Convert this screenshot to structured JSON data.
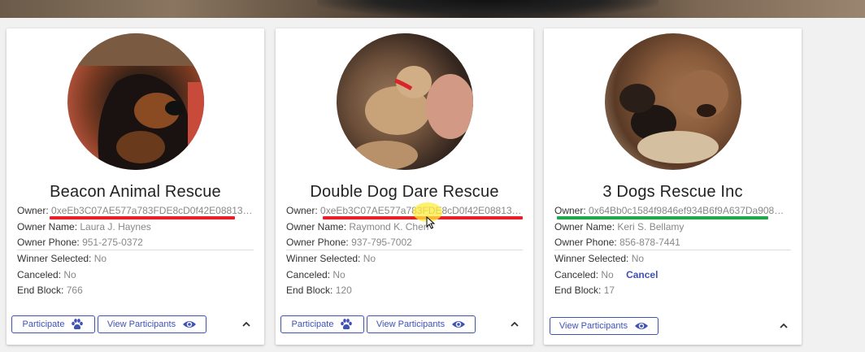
{
  "labels": {
    "owner": "Owner:",
    "owner_name": "Owner Name:",
    "owner_phone": "Owner Phone:",
    "winner_selected": "Winner Selected:",
    "canceled": "Canceled:",
    "end_block": "End Block:",
    "participate": "Participate",
    "view_participants": "View Participants",
    "cancel": "Cancel"
  },
  "cards": [
    {
      "title": "Beacon Animal Rescue",
      "owner": "0xeEb3C07AE577a783FDE8cD0f42E0881329…",
      "owner_name": "Laura J. Haynes",
      "owner_phone": "951-275-0372",
      "winner_selected": "No",
      "canceled": "No",
      "end_block": "766",
      "underline_color": "#e8202a"
    },
    {
      "title": "Double Dog Dare Rescue",
      "owner": "0xeEb3C07AE577a783FDE8cD0f42E0881329…",
      "owner_name": "Raymond K. Chen",
      "owner_phone": "937-795-7002",
      "winner_selected": "No",
      "canceled": "No",
      "end_block": "120",
      "underline_color": "#e8202a"
    },
    {
      "title": "3 Dogs Rescue Inc",
      "owner": "0x64Bb0c1584f9846ef934B6f9A637Da908DC…",
      "owner_name": "Keri S. Bellamy",
      "owner_phone": "856-878-7441",
      "winner_selected": "No",
      "canceled": "No",
      "end_block": "17",
      "underline_color": "#1faa4a"
    }
  ]
}
